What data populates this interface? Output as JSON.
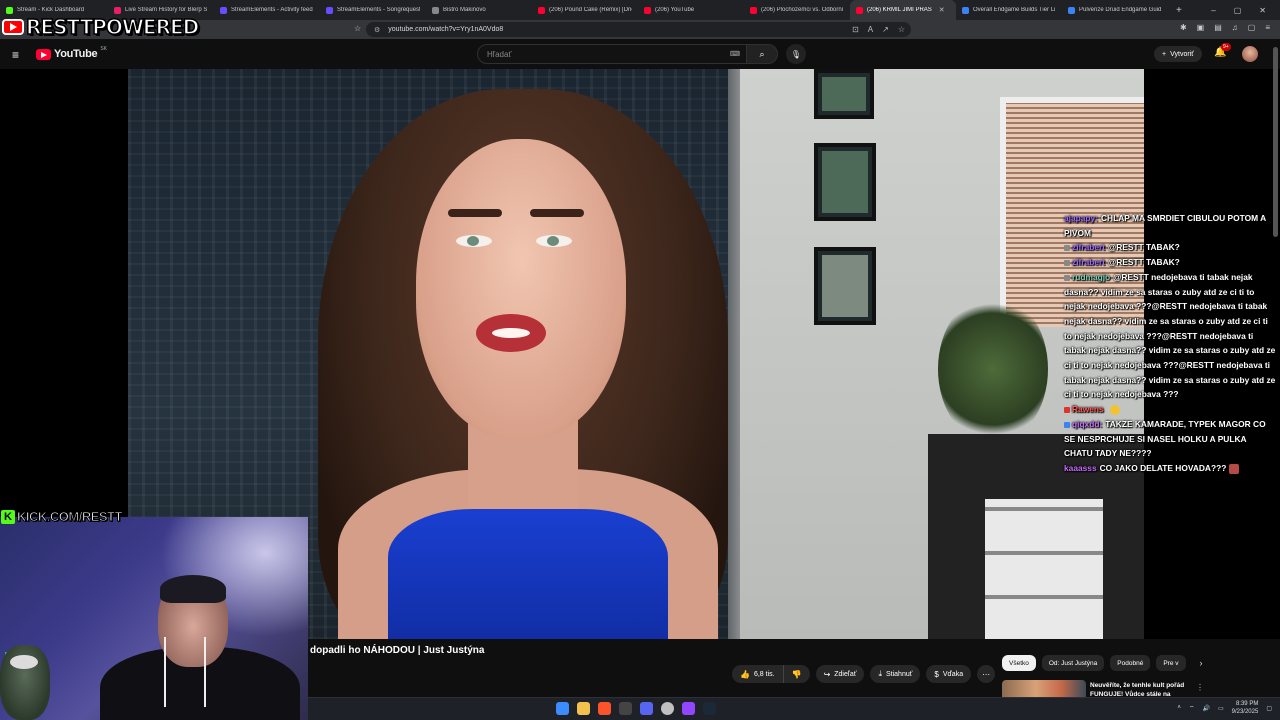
{
  "browser": {
    "tabs": [
      {
        "label": "Stream - Kick Dashboard",
        "color": "#53fc18"
      },
      {
        "label": "Live Stream History for Blerp S",
        "color": "#e91e63"
      },
      {
        "label": "StreamElements - Activity feed",
        "color": "#6a4bff"
      },
      {
        "label": "StreamElements - Songrequest",
        "color": "#6a4bff"
      },
      {
        "label": "Bistro Makinovo",
        "color": "#888888"
      },
      {
        "label": "(206) Pound Cake (Remix) [Drie",
        "color": "#ff0033"
      },
      {
        "label": "(206) YouTube",
        "color": "#ff0033"
      },
      {
        "label": "(206) Plochozemci vs. Odborní",
        "color": "#ff0033"
      },
      {
        "label": "(206) KRMIL JIMI PRAS",
        "color": "#ff0033",
        "active": true
      },
      {
        "label": "Overall Endgame Builds Tier Li",
        "color": "#3b82f6"
      },
      {
        "label": "Pulverize Druid Endgame Guid",
        "color": "#3b82f6"
      }
    ],
    "new_tab": "+",
    "url": "youtube.com/watch?v=Yry1nA0Vdo8"
  },
  "youtube": {
    "logo_text": "YouTube",
    "country": "SK",
    "search_placeholder": "Hľadať",
    "create_label": "Vytvoriť",
    "notif_count": "9+",
    "video_title": "dopadli ho NÁHODOU | Just Justýna",
    "actions": {
      "likes": "6,8 tis.",
      "share": "Zdieľať",
      "download": "Stiahnuť",
      "thanks": "Vďaka"
    },
    "chips": [
      "Všetko",
      "Od: Just Justýna",
      "Podobné",
      "Pre v"
    ],
    "rec_title": "Neuvěříte, že tenhle kult pořád FUNGUJE! Vůdce stále na"
  },
  "overlay": {
    "channel_logo": "RESTTPOWERED",
    "kick_url": "KICK.COM/RESTT"
  },
  "chat": [
    {
      "user": "ajapapy:",
      "user_color": "#9b6bff",
      "text": "CHLAP MA SMRDIET CIBULOU POTOM A PIVOM",
      "badge": ""
    },
    {
      "user": "zifrabert",
      "user_color": "#9b6bff",
      "text": "@RESTT TABAK?",
      "badge": "#888888"
    },
    {
      "user": "zifrabert",
      "user_color": "#9b6bff",
      "text": "@RESTT TABAK?",
      "badge": "#888888"
    },
    {
      "user": "rudmagjo",
      "user_color": "#7fd1b9",
      "text": "@RESTT nedojebava ti tabak nejak dasna?? vidim ze sa staras o zuby atd ze ci ti to nejak nedojebava ???@RESTT nedojebava ti tabak nejak dasna?? vidim ze sa staras o zuby atd ze ci ti to nejak nedojebava ???@RESTT nedojebava ti tabak nejak dasna?? vidim ze sa staras o zuby atd ze ci ti to nejak nedojebava ???@RESTT nedojebava ti tabak nejak dasna?? vidim ze sa staras o zuby atd ze ci ti to nejak nedojebava ???",
      "badge": "#888888"
    },
    {
      "user": "Rawens",
      "user_color": "#ff5a5a",
      "text": "",
      "badge": "#d33",
      "emote": "yellow"
    },
    {
      "user": "qiqxdd:",
      "user_color": "#c86bff",
      "text": "TAKZE KAMARADE, TYPEK MAGOR CO SE NESPRCHUJE SI NASEL HOLKU A PULKA CHATU TADY NE????",
      "badge": "#3b82f6"
    },
    {
      "user": "kaaasss",
      "user_color": "#c86bff",
      "text": "CO JAKO DELATE HOVADA???",
      "badge": "",
      "emote": "red"
    }
  ],
  "taskbar": {
    "time": "8:39 PM",
    "date": "9/23/2025"
  }
}
